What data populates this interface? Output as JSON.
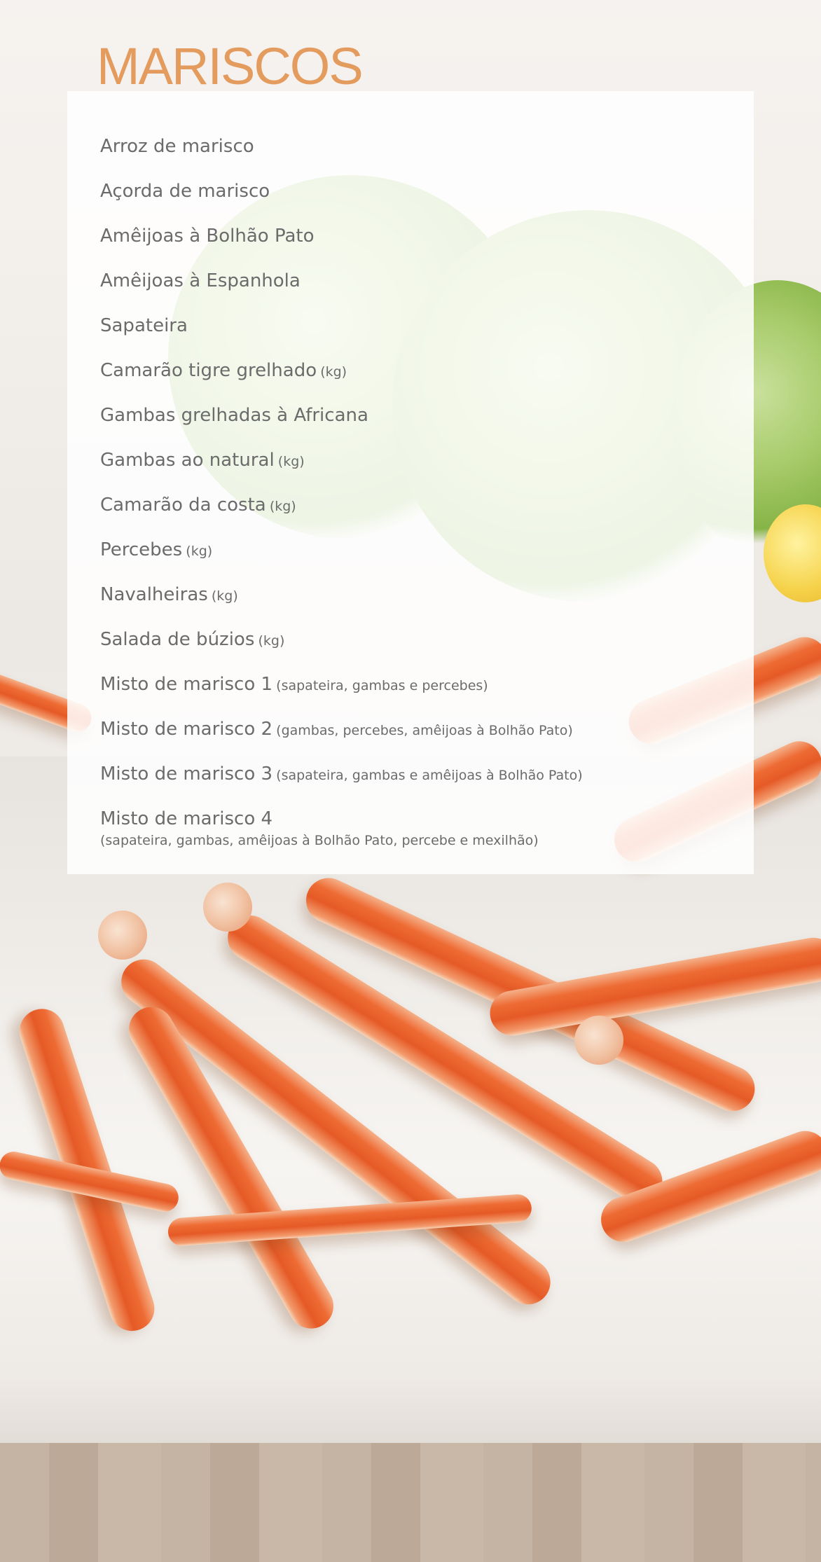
{
  "page": {
    "title": "MARISCOS",
    "colors": {
      "title": "#e39b5e",
      "text": "#6b6b6b",
      "panel": "#ffffff"
    },
    "background": "crab-legs-photo"
  },
  "menu": [
    {
      "name": "Arroz de marisco",
      "note": ""
    },
    {
      "name": "Açorda de marisco",
      "note": ""
    },
    {
      "name": "Amêijoas à Bolhão Pato",
      "note": ""
    },
    {
      "name": "Amêijoas à Espanhola",
      "note": ""
    },
    {
      "name": "Sapateira",
      "note": ""
    },
    {
      "name": "Camarão tigre grelhado",
      "note": "(kg)"
    },
    {
      "name": "Gambas grelhadas à Africana",
      "note": ""
    },
    {
      "name": "Gambas ao natural",
      "note": "(kg)"
    },
    {
      "name": "Camarão da costa",
      "note": "(kg)"
    },
    {
      "name": "Percebes",
      "note": "(kg)"
    },
    {
      "name": "Navalheiras",
      "note": "(kg)"
    },
    {
      "name": "Salada de búzios",
      "note": "(kg)"
    },
    {
      "name": "Misto de marisco 1",
      "note": "(sapateira, gambas e percebes)"
    },
    {
      "name": "Misto de marisco 2",
      "note": "(gambas, percebes, amêijoas à Bolhão Pato)"
    },
    {
      "name": "Misto de marisco 3",
      "note": "(sapateira, gambas e amêijoas à Bolhão Pato)"
    },
    {
      "name": "Misto de marisco 4",
      "note": "(sapateira, gambas, amêijoas à Bolhão Pato, percebe e mexilhão)"
    }
  ]
}
